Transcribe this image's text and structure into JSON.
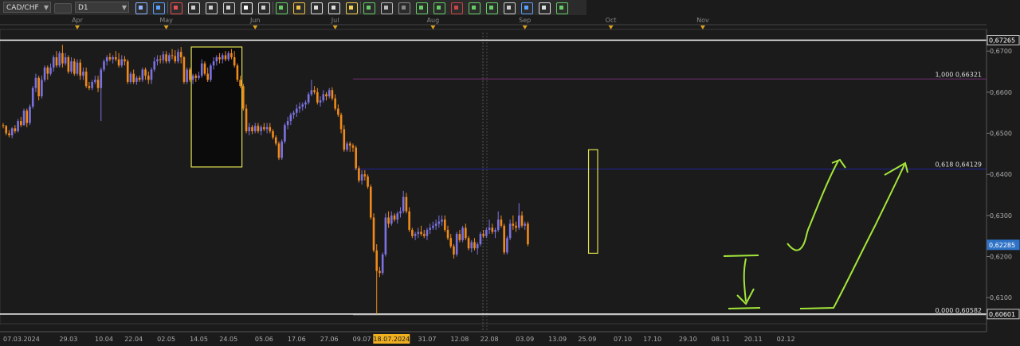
{
  "toolbar": {
    "symbol": "CAD/CHF",
    "timeframe": "D1",
    "buttons": [
      {
        "icon": "chart-type-icon",
        "color": "#8fb4ff"
      },
      {
        "icon": "crosshair-icon",
        "color": "#5aa0ff"
      },
      {
        "icon": "indicator-icon",
        "color": "#e05050"
      },
      {
        "icon": "zoom-in-icon",
        "color": "#cfcfcf"
      },
      {
        "icon": "zoom-out-icon",
        "color": "#cfcfcf"
      },
      {
        "icon": "magnet-icon",
        "color": "#cfcfcf"
      },
      {
        "icon": "dot-icon",
        "color": "#ffffff"
      },
      {
        "icon": "scroll-icon",
        "color": "#cfcfcf"
      },
      {
        "icon": "text-tool-icon",
        "color": "#66cc66"
      },
      {
        "icon": "template-icon",
        "color": "#f0c040"
      },
      {
        "icon": "clone-icon",
        "color": "#dddddd"
      },
      {
        "icon": "settings-icon",
        "color": "#dddddd"
      },
      {
        "icon": "pen-icon",
        "color": "#f0d050"
      },
      {
        "icon": "object-list-icon",
        "color": "#66cc66"
      },
      {
        "icon": "window-icon",
        "color": "#bbbbbb"
      },
      {
        "icon": "line-tool-icon",
        "color": "#888888"
      },
      {
        "icon": "grid-icon",
        "color": "#66cc66"
      },
      {
        "icon": "hline-icon",
        "color": "#66cc66"
      },
      {
        "icon": "ray-icon",
        "color": "#cc4444"
      },
      {
        "icon": "trend-icon",
        "color": "#66cc66"
      },
      {
        "icon": "channel-icon",
        "color": "#66cc66"
      },
      {
        "icon": "sphere-icon",
        "color": "#cccccc"
      },
      {
        "icon": "flag-icon",
        "color": "#5aa0ff"
      },
      {
        "icon": "eraser-icon",
        "color": "#dddddd"
      },
      {
        "icon": "layout-icon",
        "color": "#66cc66"
      }
    ]
  },
  "chart_data": {
    "type": "candlestick",
    "symbol": "CAD/CHF",
    "timeframe": "D1",
    "ylim": [
      0.6052,
      0.6743
    ],
    "grid": false,
    "colors": {
      "up": "#7b72e0",
      "down": "#f08a1a",
      "fib_upper": "#7a2e7a",
      "fib_618": "#22249a",
      "level_lines": "#ffffff",
      "annotations": "#a4e63a",
      "boxes": "#e0e050"
    },
    "month_labels": [
      {
        "label": "Apr",
        "day": 25
      },
      {
        "label": "May",
        "day": 55
      },
      {
        "label": "Jun",
        "day": 85
      },
      {
        "label": "Jul",
        "day": 112
      },
      {
        "label": "Aug",
        "day": 145
      },
      {
        "label": "Sep",
        "day": 176
      },
      {
        "label": "Oct",
        "day": 205
      },
      {
        "label": "Nov",
        "day": 236
      }
    ],
    "date_labels": [
      {
        "label": "07.03.2024",
        "day": 0
      },
      {
        "label": "29.03",
        "day": 22
      },
      {
        "label": "10.04",
        "day": 34
      },
      {
        "label": "22.04",
        "day": 44
      },
      {
        "label": "02.05",
        "day": 55
      },
      {
        "label": "14.05",
        "day": 66
      },
      {
        "label": "24.05",
        "day": 76
      },
      {
        "label": "05.06",
        "day": 88
      },
      {
        "label": "17.06",
        "day": 99
      },
      {
        "label": "27.06",
        "day": 110
      },
      {
        "label": "09.07",
        "day": 121
      },
      {
        "label": "18.07.2024",
        "day": 131,
        "highlight": true
      },
      {
        "label": "31.07",
        "day": 143
      },
      {
        "label": "12.08",
        "day": 154
      },
      {
        "label": "22.08",
        "day": 164
      },
      {
        "label": "03.09",
        "day": 176
      },
      {
        "label": "13.09",
        "day": 187
      },
      {
        "label": "25.09",
        "day": 197
      },
      {
        "label": "07.10",
        "day": 209
      },
      {
        "label": "17.10",
        "day": 219
      },
      {
        "label": "29.10",
        "day": 231
      },
      {
        "label": "08.11",
        "day": 242
      },
      {
        "label": "20.11",
        "day": 253
      },
      {
        "label": "02.12",
        "day": 264
      }
    ],
    "price_labels": [
      "0,6726",
      "0,6700",
      "0,6600",
      "0,6500",
      "0,6400",
      "0,6300",
      "0,6200",
      "0,6100"
    ],
    "price_values": [
      0.67265,
      0.67,
      0.66,
      0.65,
      0.64,
      0.63,
      0.62,
      0.61
    ],
    "price_label_boxes": [
      {
        "text": "0,67265",
        "value": 0.67265,
        "style": "outline"
      },
      {
        "text": "0,62285",
        "value": 0.62285,
        "style": "blue"
      },
      {
        "text": "0,60601",
        "value": 0.60601,
        "style": "outline"
      }
    ],
    "fib_levels": [
      {
        "label": "1,000 0,66321",
        "value": 0.66321,
        "from_day": 118,
        "color": "#7a2e7a"
      },
      {
        "label": "0,618 0,64129",
        "value": 0.64129,
        "from_day": 118,
        "color": "#22249a"
      },
      {
        "label": "0,000 0,60582",
        "value": 0.60582,
        "from_day": 118,
        "color": "#aaaaaa"
      }
    ],
    "horizontal_lines": [
      0.67265,
      0.60601
    ],
    "candles": [
      [
        0.652,
        0.6525,
        0.6512,
        0.6518
      ],
      [
        0.6518,
        0.652,
        0.6495,
        0.65
      ],
      [
        0.65,
        0.6508,
        0.649,
        0.6495
      ],
      [
        0.6495,
        0.6515,
        0.6488,
        0.6512
      ],
      [
        0.6512,
        0.652,
        0.65,
        0.6505
      ],
      [
        0.6505,
        0.6535,
        0.6502,
        0.653
      ],
      [
        0.653,
        0.654,
        0.6515,
        0.652
      ],
      [
        0.652,
        0.656,
        0.6518,
        0.6555
      ],
      [
        0.6555,
        0.656,
        0.6515,
        0.6525
      ],
      [
        0.6525,
        0.657,
        0.652,
        0.6565
      ],
      [
        0.6565,
        0.6615,
        0.656,
        0.661
      ],
      [
        0.661,
        0.6645,
        0.66,
        0.6635
      ],
      [
        0.6635,
        0.664,
        0.658,
        0.659
      ],
      [
        0.659,
        0.664,
        0.6585,
        0.663
      ],
      [
        0.663,
        0.6665,
        0.6625,
        0.666
      ],
      [
        0.666,
        0.6665,
        0.663,
        0.6645
      ],
      [
        0.6645,
        0.667,
        0.664,
        0.666
      ],
      [
        0.666,
        0.669,
        0.665,
        0.6685
      ],
      [
        0.6685,
        0.67,
        0.666,
        0.6665
      ],
      [
        0.6665,
        0.67,
        0.666,
        0.6695
      ],
      [
        0.6695,
        0.6715,
        0.666,
        0.667
      ],
      [
        0.667,
        0.6695,
        0.6665,
        0.6685
      ],
      [
        0.6685,
        0.669,
        0.6645,
        0.665
      ],
      [
        0.665,
        0.6685,
        0.6645,
        0.6675
      ],
      [
        0.6675,
        0.6682,
        0.664,
        0.6645
      ],
      [
        0.6645,
        0.668,
        0.664,
        0.6672
      ],
      [
        0.6672,
        0.668,
        0.663,
        0.664
      ],
      [
        0.664,
        0.666,
        0.663,
        0.665
      ],
      [
        0.665,
        0.666,
        0.661,
        0.6615
      ],
      [
        0.6615,
        0.6625,
        0.6605,
        0.661
      ],
      [
        0.661,
        0.663,
        0.6605,
        0.6625
      ],
      [
        0.6625,
        0.664,
        0.662,
        0.663
      ],
      [
        0.663,
        0.664,
        0.66,
        0.661
      ],
      [
        0.661,
        0.666,
        0.653,
        0.6655
      ],
      [
        0.6655,
        0.668,
        0.665,
        0.6675
      ],
      [
        0.6675,
        0.669,
        0.6665,
        0.6685
      ],
      [
        0.6685,
        0.6695,
        0.6675,
        0.668
      ],
      [
        0.668,
        0.669,
        0.667,
        0.6685
      ],
      [
        0.6685,
        0.67,
        0.6675,
        0.668
      ],
      [
        0.668,
        0.6695,
        0.666,
        0.6665
      ],
      [
        0.6665,
        0.669,
        0.666,
        0.668
      ],
      [
        0.668,
        0.6688,
        0.6665,
        0.6675
      ],
      [
        0.6675,
        0.668,
        0.662,
        0.6625
      ],
      [
        0.6625,
        0.665,
        0.662,
        0.6645
      ],
      [
        0.6645,
        0.6655,
        0.662,
        0.6625
      ],
      [
        0.6625,
        0.664,
        0.6618,
        0.6635
      ],
      [
        0.6635,
        0.664,
        0.6625,
        0.663
      ],
      [
        0.663,
        0.666,
        0.6625,
        0.6655
      ],
      [
        0.6655,
        0.666,
        0.663,
        0.664
      ],
      [
        0.664,
        0.665,
        0.662,
        0.663
      ],
      [
        0.663,
        0.666,
        0.662,
        0.6655
      ],
      [
        0.6655,
        0.6685,
        0.665,
        0.6675
      ],
      [
        0.6675,
        0.669,
        0.6665,
        0.668
      ],
      [
        0.668,
        0.669,
        0.667,
        0.6678
      ],
      [
        0.6678,
        0.67,
        0.667,
        0.6692
      ],
      [
        0.6692,
        0.67,
        0.667,
        0.6675
      ],
      [
        0.6675,
        0.6695,
        0.667,
        0.669
      ],
      [
        0.669,
        0.6705,
        0.668,
        0.6688
      ],
      [
        0.6688,
        0.6702,
        0.667,
        0.6675
      ],
      [
        0.6675,
        0.6705,
        0.667,
        0.6698
      ],
      [
        0.6698,
        0.671,
        0.667,
        0.6685
      ],
      [
        0.6685,
        0.6688,
        0.662,
        0.6625
      ],
      [
        0.6625,
        0.666,
        0.662,
        0.6655
      ],
      [
        0.6655,
        0.666,
        0.6625,
        0.663
      ],
      [
        0.663,
        0.6645,
        0.662,
        0.664
      ],
      [
        0.664,
        0.6645,
        0.6625,
        0.6635
      ],
      [
        0.6635,
        0.665,
        0.663,
        0.664
      ],
      [
        0.664,
        0.668,
        0.6635,
        0.667
      ],
      [
        0.667,
        0.6675,
        0.664,
        0.6645
      ],
      [
        0.6645,
        0.666,
        0.6625,
        0.663
      ],
      [
        0.663,
        0.667,
        0.6625,
        0.6665
      ],
      [
        0.6665,
        0.6685,
        0.6655,
        0.6675
      ],
      [
        0.6675,
        0.669,
        0.6665,
        0.6685
      ],
      [
        0.6685,
        0.6695,
        0.667,
        0.668
      ],
      [
        0.668,
        0.6695,
        0.667,
        0.669
      ],
      [
        0.669,
        0.67,
        0.6675,
        0.668
      ],
      [
        0.668,
        0.67,
        0.6675,
        0.6695
      ],
      [
        0.6695,
        0.6705,
        0.668,
        0.6685
      ],
      [
        0.6685,
        0.67,
        0.666,
        0.6665
      ],
      [
        0.6665,
        0.667,
        0.6625,
        0.663
      ],
      [
        0.663,
        0.664,
        0.661,
        0.6615
      ],
      [
        0.6615,
        0.662,
        0.6555,
        0.656
      ],
      [
        0.656,
        0.657,
        0.65,
        0.6505
      ],
      [
        0.6505,
        0.6525,
        0.6495,
        0.6515
      ],
      [
        0.6515,
        0.652,
        0.6498,
        0.6505
      ],
      [
        0.6505,
        0.6525,
        0.65,
        0.6518
      ],
      [
        0.6518,
        0.6525,
        0.65,
        0.6505
      ],
      [
        0.6505,
        0.652,
        0.6495,
        0.6515
      ],
      [
        0.6515,
        0.6525,
        0.6505,
        0.651
      ],
      [
        0.651,
        0.6525,
        0.65,
        0.6515
      ],
      [
        0.6515,
        0.6525,
        0.65,
        0.6505
      ],
      [
        0.6505,
        0.651,
        0.6485,
        0.649
      ],
      [
        0.649,
        0.6495,
        0.647,
        0.6475
      ],
      [
        0.6475,
        0.648,
        0.6435,
        0.644
      ],
      [
        0.644,
        0.6485,
        0.6435,
        0.648
      ],
      [
        0.648,
        0.6525,
        0.6475,
        0.652
      ],
      [
        0.652,
        0.654,
        0.651,
        0.653
      ],
      [
        0.653,
        0.655,
        0.652,
        0.6545
      ],
      [
        0.6545,
        0.6555,
        0.6535,
        0.655
      ],
      [
        0.655,
        0.657,
        0.654,
        0.656
      ],
      [
        0.656,
        0.6575,
        0.655,
        0.6565
      ],
      [
        0.6565,
        0.6575,
        0.6555,
        0.657
      ],
      [
        0.657,
        0.658,
        0.656,
        0.6575
      ],
      [
        0.6575,
        0.66,
        0.657,
        0.6595
      ],
      [
        0.6595,
        0.663,
        0.659,
        0.6605
      ],
      [
        0.6605,
        0.6615,
        0.6595,
        0.66
      ],
      [
        0.66,
        0.661,
        0.657,
        0.6575
      ],
      [
        0.6575,
        0.659,
        0.6565,
        0.658
      ],
      [
        0.658,
        0.6605,
        0.6575,
        0.6595
      ],
      [
        0.6595,
        0.66,
        0.658,
        0.659
      ],
      [
        0.659,
        0.661,
        0.6585,
        0.6605
      ],
      [
        0.6605,
        0.6612,
        0.658,
        0.6585
      ],
      [
        0.6585,
        0.6595,
        0.6555,
        0.656
      ],
      [
        0.656,
        0.657,
        0.654,
        0.6545
      ],
      [
        0.6545,
        0.655,
        0.65,
        0.651
      ],
      [
        0.651,
        0.652,
        0.6455,
        0.646
      ],
      [
        0.646,
        0.648,
        0.6455,
        0.6475
      ],
      [
        0.6475,
        0.648,
        0.6455,
        0.647
      ],
      [
        0.647,
        0.6475,
        0.6455,
        0.6465
      ],
      [
        0.6465,
        0.647,
        0.641,
        0.6415
      ],
      [
        0.6415,
        0.642,
        0.638,
        0.6385
      ],
      [
        0.6385,
        0.641,
        0.6375,
        0.64
      ],
      [
        0.64,
        0.641,
        0.6385,
        0.6395
      ],
      [
        0.6395,
        0.64,
        0.6365,
        0.637
      ],
      [
        0.637,
        0.6375,
        0.629,
        0.6295
      ],
      [
        0.6295,
        0.6305,
        0.621,
        0.6215
      ],
      [
        0.6215,
        0.623,
        0.606,
        0.6165
      ],
      [
        0.6165,
        0.6175,
        0.615,
        0.616
      ],
      [
        0.616,
        0.621,
        0.6155,
        0.6205
      ],
      [
        0.6205,
        0.6305,
        0.62,
        0.6295
      ],
      [
        0.6295,
        0.631,
        0.627,
        0.628
      ],
      [
        0.628,
        0.631,
        0.6275,
        0.63
      ],
      [
        0.63,
        0.6305,
        0.6285,
        0.629
      ],
      [
        0.629,
        0.631,
        0.628,
        0.6305
      ],
      [
        0.6305,
        0.632,
        0.6295,
        0.631
      ],
      [
        0.631,
        0.636,
        0.6305,
        0.6345
      ],
      [
        0.6345,
        0.6355,
        0.6305,
        0.631
      ],
      [
        0.631,
        0.632,
        0.626,
        0.6265
      ],
      [
        0.6265,
        0.627,
        0.6245,
        0.625
      ],
      [
        0.625,
        0.626,
        0.624,
        0.6255
      ],
      [
        0.6255,
        0.627,
        0.6245,
        0.626
      ],
      [
        0.626,
        0.6275,
        0.625,
        0.6255
      ],
      [
        0.6255,
        0.6265,
        0.6245,
        0.625
      ],
      [
        0.625,
        0.627,
        0.624,
        0.6265
      ],
      [
        0.6265,
        0.628,
        0.6255,
        0.627
      ],
      [
        0.627,
        0.6285,
        0.6265,
        0.6275
      ],
      [
        0.6275,
        0.629,
        0.6265,
        0.628
      ],
      [
        0.628,
        0.63,
        0.627,
        0.6285
      ],
      [
        0.6285,
        0.63,
        0.6275,
        0.629
      ],
      [
        0.629,
        0.63,
        0.626,
        0.6265
      ],
      [
        0.6265,
        0.6275,
        0.624,
        0.6245
      ],
      [
        0.6245,
        0.6255,
        0.622,
        0.6225
      ],
      [
        0.6225,
        0.623,
        0.6195,
        0.6205
      ],
      [
        0.6205,
        0.626,
        0.62,
        0.6255
      ],
      [
        0.6255,
        0.6265,
        0.6235,
        0.624
      ],
      [
        0.624,
        0.6275,
        0.6235,
        0.627
      ],
      [
        0.627,
        0.628,
        0.624,
        0.6245
      ],
      [
        0.6245,
        0.625,
        0.6215,
        0.622
      ],
      [
        0.622,
        0.624,
        0.621,
        0.6235
      ],
      [
        0.6235,
        0.6245,
        0.6215,
        0.622
      ],
      [
        0.622,
        0.6235,
        0.6205,
        0.623
      ],
      [
        0.623,
        0.626,
        0.6225,
        0.6255
      ],
      [
        0.6255,
        0.6265,
        0.6245,
        0.625
      ],
      [
        0.625,
        0.627,
        0.6245,
        0.6265
      ],
      [
        0.6265,
        0.629,
        0.6255,
        0.627
      ],
      [
        0.627,
        0.628,
        0.6255,
        0.626
      ],
      [
        0.626,
        0.627,
        0.6245,
        0.6265
      ],
      [
        0.6265,
        0.631,
        0.626,
        0.629
      ],
      [
        0.629,
        0.63,
        0.627,
        0.6275
      ],
      [
        0.6275,
        0.628,
        0.6205,
        0.621
      ],
      [
        0.621,
        0.625,
        0.6205,
        0.6245
      ],
      [
        0.6245,
        0.629,
        0.624,
        0.628
      ],
      [
        0.628,
        0.63,
        0.6265,
        0.6275
      ],
      [
        0.6275,
        0.6285,
        0.626,
        0.627
      ],
      [
        0.627,
        0.633,
        0.6265,
        0.63
      ],
      [
        0.63,
        0.631,
        0.627,
        0.6275
      ],
      [
        0.6275,
        0.6285,
        0.6265,
        0.628
      ],
      [
        0.628,
        0.6285,
        0.6225,
        0.623
      ]
    ],
    "boxes": [
      {
        "from_day": 64,
        "to_day": 80,
        "top": 0.671,
        "bottom": 0.6418,
        "fill": "#0b0b0b"
      },
      {
        "from_day": 198,
        "to_day": 200,
        "top": 0.646,
        "bottom": 0.6208,
        "fill": "none"
      }
    ]
  }
}
